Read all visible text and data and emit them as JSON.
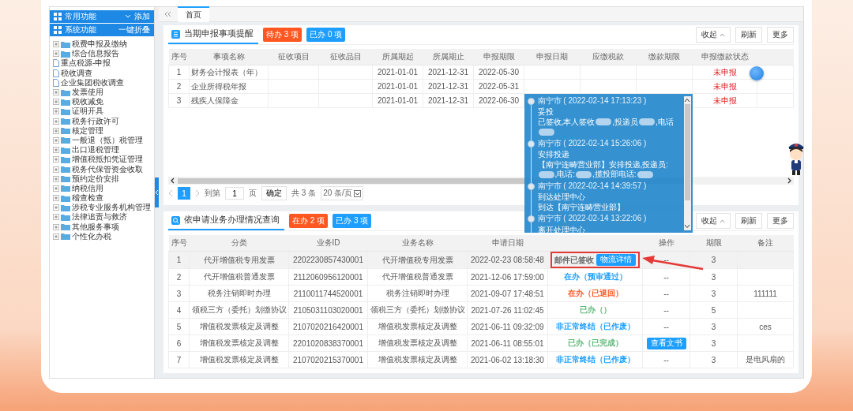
{
  "tab_bar": {
    "tabs": [
      {
        "label": "首页",
        "selected": true
      }
    ]
  },
  "sidebar": {
    "groups": [
      {
        "title": "常用功能",
        "caret": true,
        "action": "添加"
      },
      {
        "title": "系统功能",
        "caret": false,
        "action": "一键折叠"
      }
    ],
    "items": [
      {
        "label": "税费申报及缴纳",
        "kind": "folder"
      },
      {
        "label": "综合信息报告",
        "kind": "folder"
      },
      {
        "label": "重点税源-申报",
        "kind": "page"
      },
      {
        "label": "税收调查",
        "kind": "page"
      },
      {
        "label": "企业集团税收调查",
        "kind": "page"
      },
      {
        "label": "发票使用",
        "kind": "folder"
      },
      {
        "label": "税收减免",
        "kind": "folder"
      },
      {
        "label": "证明开具",
        "kind": "folder"
      },
      {
        "label": "税务行政许可",
        "kind": "folder"
      },
      {
        "label": "核定管理",
        "kind": "folder"
      },
      {
        "label": "一般退（抵）税管理",
        "kind": "folder"
      },
      {
        "label": "出口退税管理",
        "kind": "folder"
      },
      {
        "label": "增值税抵扣凭证管理",
        "kind": "folder"
      },
      {
        "label": "税务代保管资金收取",
        "kind": "folder"
      },
      {
        "label": "预约定价安排",
        "kind": "folder"
      },
      {
        "label": "纳税信用",
        "kind": "folder"
      },
      {
        "label": "稽查检查",
        "kind": "folder"
      },
      {
        "label": "涉税专业服务机构管理",
        "kind": "folder"
      },
      {
        "label": "法律追责与救济",
        "kind": "folder"
      },
      {
        "label": "其他服务事项",
        "kind": "folder"
      },
      {
        "label": "个性化办税",
        "kind": "folder"
      }
    ]
  },
  "declaration_panel": {
    "title": "当期申报事项提醒",
    "badges": [
      {
        "text": "待办 3 项",
        "color": "#ff5722"
      },
      {
        "text": "已办 0 项",
        "color": "#1e9fff"
      }
    ],
    "buttons": [
      {
        "label": "收起",
        "caret": true
      },
      {
        "label": "刷新",
        "caret": false
      },
      {
        "label": "更多",
        "caret": false
      }
    ],
    "table": {
      "columns": [
        "序号",
        "事项名称",
        "征收项目",
        "征收品目",
        "所属期起",
        "所属期止",
        "申报期限",
        "申报日期",
        "应缴税款",
        "缴款期限",
        "申报缴款状态"
      ],
      "rows": [
        {
          "index": "1",
          "item_name": "财务会计报表（年）",
          "period_start": "2021-01-01",
          "period_end": "2021-12-31",
          "deadline": "2022-05-30",
          "status": "未申报"
        },
        {
          "index": "2",
          "item_name": "企业所得税年报",
          "period_start": "2021-01-01",
          "period_end": "2021-12-31",
          "deadline": "2022-05-31",
          "status": "未申报"
        },
        {
          "index": "3",
          "item_name": "残疾人保障金",
          "period_start": "2021-01-01",
          "period_end": "2021-12-31",
          "deadline": "2022-06-30",
          "status": "未申报"
        }
      ]
    },
    "pager": {
      "pages": [
        {
          "label": "1",
          "selected": true
        }
      ],
      "goto_label": "到第",
      "goto_value": "1",
      "page_unit": "页",
      "confirm": "确定",
      "total": "共 3 条",
      "page_size": "20 条/页"
    }
  },
  "application_panel": {
    "title": "依申请业务办理情况查询",
    "badges": [
      {
        "text": "在办 2 项",
        "color": "#ff5722"
      },
      {
        "text": "已办 3 项",
        "color": "#1e9fff"
      }
    ],
    "buttons": [
      {
        "label": "收起",
        "caret": true
      },
      {
        "label": "刷新",
        "caret": false
      },
      {
        "label": "更多",
        "caret": false
      }
    ],
    "table": {
      "columns": [
        "序号",
        "分类",
        "业务ID",
        "业务名称",
        "申请日期",
        "操作",
        "期限",
        "备注"
      ],
      "rows": [
        {
          "selected": true,
          "index": "1",
          "category": "代开增值税专用发票",
          "business_id": "2202230857430001",
          "business_name": "代开增值税专用发票",
          "apply_date": "2022-02-23 08:58:48",
          "status": "邮件已签收",
          "color": "#666666",
          "status_button": "物流详情",
          "highlighted": true,
          "action": {
            "kind": "text",
            "label": "--"
          },
          "time_limit": "3"
        },
        {
          "selected": false,
          "index": "2",
          "category": "代开增值税普通发票",
          "business_id": "2112060956120001",
          "business_name": "代开增值税普通发票",
          "apply_date": "2021-12-06 17:59:00",
          "status": "在办（预审通过）",
          "color": "#1e9fff",
          "highlighted": false,
          "action": {
            "kind": "text",
            "label": "--"
          },
          "time_limit": "3"
        },
        {
          "selected": false,
          "index": "3",
          "category": "税务注销即时办理",
          "business_id": "2110011744520001",
          "business_name": "税务注销即时办理",
          "apply_date": "2021-09-07 17:48:51",
          "status": "在办（已退回）",
          "color": "#ff5722",
          "highlighted": false,
          "action": {
            "kind": "text",
            "label": "--"
          },
          "time_limit": "3",
          "remark": "111111"
        },
        {
          "selected": false,
          "index": "4",
          "category": "领税三方（委托）划缴协议",
          "business_id": "2105031103020001",
          "business_name": "领税三方（委托）划缴协议",
          "apply_date": "2021-07-26 11:02:45",
          "status": "已办（）",
          "color": "#5fb878",
          "highlighted": false,
          "action": {
            "kind": "text",
            "label": "--"
          },
          "time_limit": "5"
        },
        {
          "selected": false,
          "index": "5",
          "category": "增值税发票核定及调整",
          "business_id": "2107020216420001",
          "business_name": "增值税发票核定及调整",
          "apply_date": "2021-06-11 09:32:09",
          "status": "非正常终结（已作废）",
          "color": "#1e9fff",
          "highlighted": false,
          "action": {
            "kind": "text",
            "label": "--"
          },
          "time_limit": "3",
          "remark": "ces"
        },
        {
          "selected": false,
          "index": "6",
          "category": "增值税发票核定及调整",
          "business_id": "2201020838370001",
          "business_name": "增值税发票核定及调整",
          "apply_date": "2021-06-11 08:55:01",
          "status": "已办（已完成）",
          "color": "#5fb878",
          "highlighted": false,
          "action": {
            "kind": "button",
            "label": "查看文书"
          },
          "time_limit": "3"
        },
        {
          "selected": false,
          "index": "7",
          "category": "增值税发票核定及调整",
          "business_id": "2107020215370001",
          "business_name": "增值税发票核定及调整",
          "apply_date": "2021-06-02 13:18:30",
          "status": "非正常终结（已作废）",
          "color": "#1e9fff",
          "highlighted": false,
          "action": {
            "kind": "text",
            "label": "--"
          },
          "time_limit": "3",
          "remark": "是电风扇的"
        }
      ]
    }
  },
  "logistics_popup": {
    "entries": [
      {
        "place_time": "南宁市 ( 2022-02-14 17:13:23 )",
        "status": "妥投",
        "detail": [
          {
            "kind": "text",
            "text": "已签收,本人签收"
          },
          {
            "kind": "redacted"
          },
          {
            "kind": "text",
            "text": ",投递员"
          },
          {
            "kind": "redacted"
          },
          {
            "kind": "text",
            "text": ",电话"
          },
          {
            "kind": "redacted"
          }
        ]
      },
      {
        "place_time": "南宁市 ( 2022-02-14 15:26:06 )",
        "status": "安排投递",
        "detail": [
          {
            "kind": "text",
            "text": "【南宁连畴营业部】安排投递,投递员:"
          },
          {
            "kind": "redacted"
          },
          {
            "kind": "text",
            "text": ",电话:"
          },
          {
            "kind": "redacted"
          },
          {
            "kind": "text",
            "text": ",揽投部电话:"
          },
          {
            "kind": "redacted"
          }
        ]
      },
      {
        "place_time": "南宁市 ( 2022-02-14 14:39:57 )",
        "status": "到达处理中心",
        "detail": [
          {
            "kind": "text",
            "text": "到达【南宁连畴营业部】"
          }
        ]
      },
      {
        "place_time": "南宁市 ( 2022-02-14 13:22:06 )",
        "status": "离开处理中心"
      }
    ]
  }
}
